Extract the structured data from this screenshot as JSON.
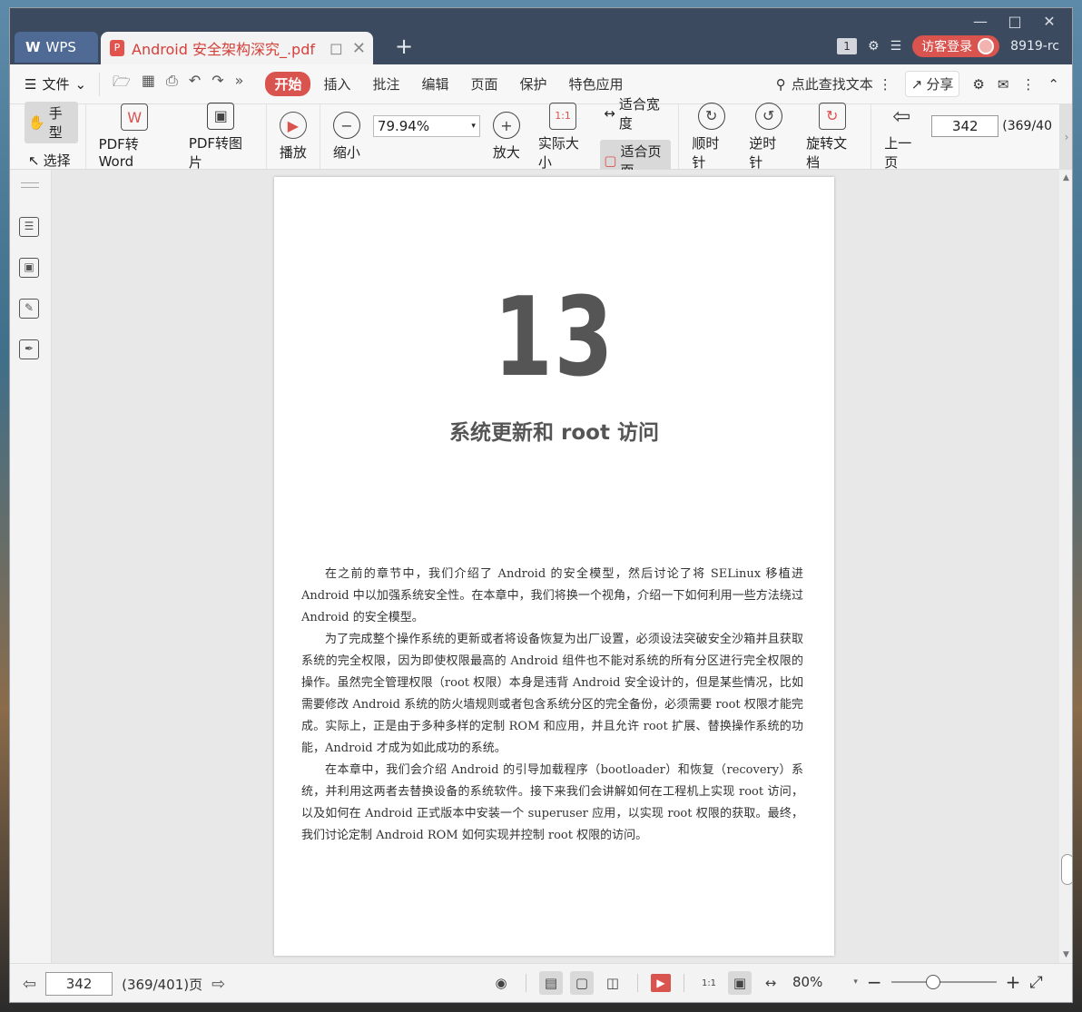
{
  "titlebar": {
    "app_tab": "WPS",
    "doc_tab": "Android 安全架构深究_.pdf",
    "add_tab": "+",
    "page_badge": "1",
    "login_label": "访客登录",
    "user_text": "8919-rc"
  },
  "menubar": {
    "file_label": "文件",
    "tabs": [
      "开始",
      "插入",
      "批注",
      "编辑",
      "页面",
      "保护",
      "特色应用"
    ],
    "find_label": "点此查找文本",
    "share_label": "分享"
  },
  "ribbon": {
    "hand_label": "手型",
    "select_label": "选择",
    "pdf_to_word": "PDF转Word",
    "pdf_to_image": "PDF转图片",
    "play": "播放",
    "zoom_out": "缩小",
    "zoom_value": "79.94%",
    "zoom_in": "放大",
    "actual_size": "实际大小",
    "fit_width": "适合宽度",
    "fit_page": "适合页面",
    "clockwise": "顺时针",
    "counter_clockwise": "逆时针",
    "rotate_doc": "旋转文档",
    "prev_page": "上一页",
    "page_number": "342",
    "page_total": "(369/40"
  },
  "document": {
    "chapter_number": "13",
    "chapter_title": "系统更新和 root 访问",
    "paragraphs": [
      "在之前的章节中，我们介绍了 Android 的安全模型，然后讨论了将 SELinux 移植进 Android 中以加强系统安全性。在本章中，我们将换一个视角，介绍一下如何利用一些方法绕过 Android 的安全模型。",
      "为了完成整个操作系统的更新或者将设备恢复为出厂设置，必须设法突破安全沙箱并且获取系统的完全权限，因为即使权限最高的 Android 组件也不能对系统的所有分区进行完全权限的操作。虽然完全管理权限（root 权限）本身是违背 Android 安全设计的，但是某些情况，比如需要修改 Android 系统的防火墙规则或者包含系统分区的完全备份，必须需要 root 权限才能完成。实际上，正是由于多种多样的定制 ROM 和应用，并且允许 root 扩展、替换操作系统的功能，Android 才成为如此成功的系统。",
      "在本章中，我们会介绍 Android 的引导加载程序（bootloader）和恢复（recovery）系统，并利用这两者去替换设备的系统软件。接下来我们会讲解如何在工程机上实现 root 访问，以及如何在 Android 正式版本中安装一个 superuser 应用，以实现 root 权限的获取。最终，我们讨论定制 Android ROM 如何实现并控制 root 权限的访问。"
    ]
  },
  "statusbar": {
    "page_number": "342",
    "page_info": "(369/401)页",
    "zoom_percent": "80%"
  },
  "colors": {
    "accent_red": "#d9534f",
    "titlebar_bg": "#3b4a5e"
  },
  "icons": {
    "hand": "hand-icon",
    "select": "cursor-icon",
    "play": "play-icon"
  }
}
